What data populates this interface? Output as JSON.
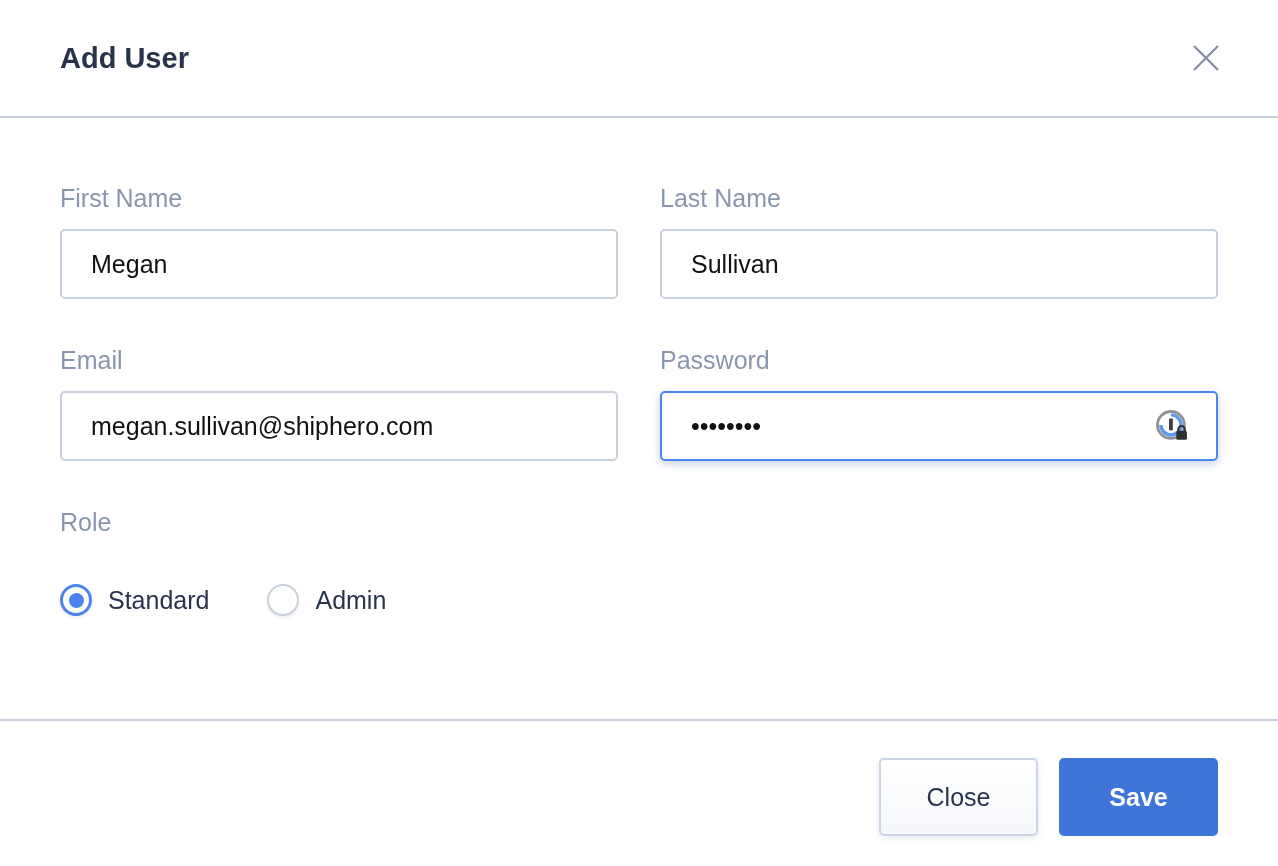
{
  "dialog": {
    "title": "Add User"
  },
  "fields": [
    {
      "label": "First Name",
      "value": "Megan",
      "kind": "text",
      "focused": false
    },
    {
      "label": "Last Name",
      "value": "Sullivan",
      "kind": "text",
      "focused": false
    },
    {
      "label": "Email",
      "value": "megan.sullivan@shiphero.com",
      "kind": "text",
      "focused": false
    },
    {
      "label": "Password",
      "value": "••••••••",
      "kind": "password",
      "focused": true
    }
  ],
  "role": {
    "label": "Role",
    "options": [
      {
        "label": "Standard",
        "selected": true
      },
      {
        "label": "Admin",
        "selected": false
      }
    ]
  },
  "buttons": [
    {
      "label": "Close",
      "kind": "secondary"
    },
    {
      "label": "Save",
      "kind": "primary"
    }
  ]
}
